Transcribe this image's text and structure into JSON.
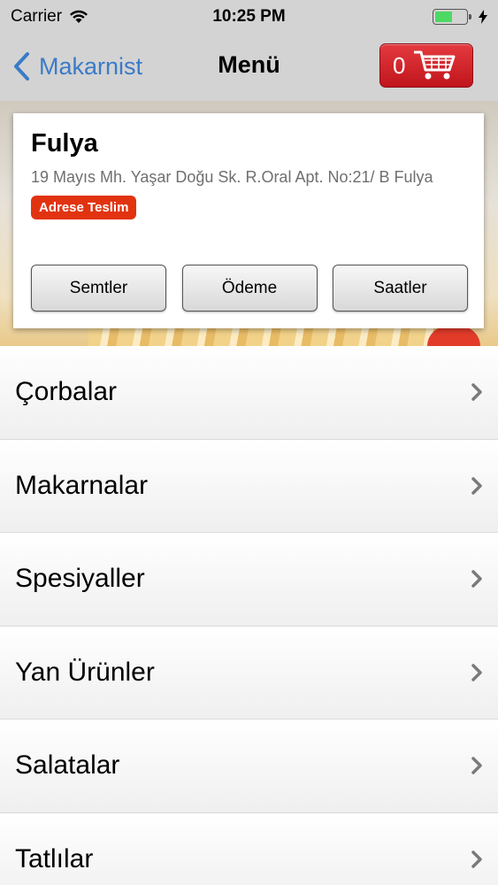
{
  "status_bar": {
    "carrier": "Carrier",
    "time": "10:25 PM",
    "battery_level": 0.55,
    "battery_color": "#4cd964"
  },
  "nav": {
    "back_label": "Makarnist",
    "title": "Menü",
    "cart_count": "0",
    "accent_color": "#3a7bc8",
    "cart_color": "#d0242a"
  },
  "restaurant": {
    "name": "Fulya",
    "address": "19 Mayıs Mh. Yaşar Doğu Sk. R.Oral Apt. No:21/ B  Fulya",
    "badge": "Adrese Teslim",
    "badge_color": "#e23310",
    "buttons": {
      "districts": "Semtler",
      "payment": "Ödeme",
      "hours": "Saatler"
    }
  },
  "menu": {
    "items": [
      {
        "label": "Çorbalar"
      },
      {
        "label": "Makarnalar"
      },
      {
        "label": "Spesiyaller"
      },
      {
        "label": "Yan Ürünler"
      },
      {
        "label": "Salatalar"
      },
      {
        "label": "Tatlılar"
      }
    ]
  }
}
